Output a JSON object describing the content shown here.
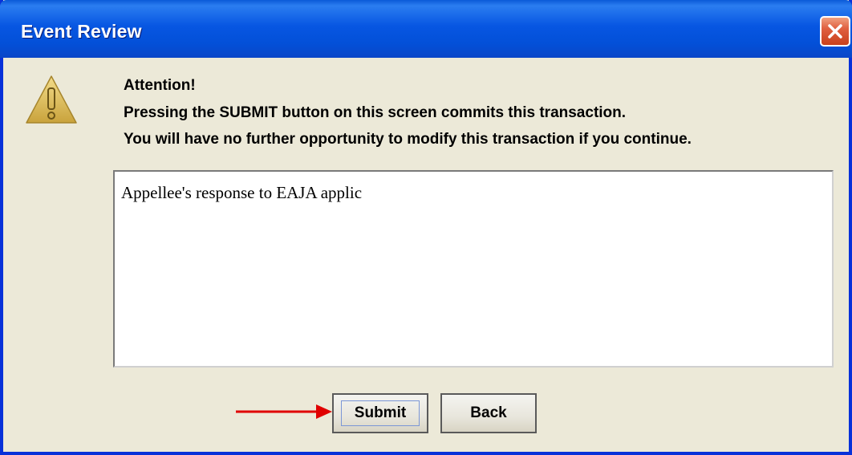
{
  "window": {
    "title": "Event Review"
  },
  "message": {
    "heading": "Attention!",
    "line1": "Pressing the SUBMIT button on this screen commits this transaction.",
    "line2": "You will have no further opportunity to modify this transaction if you continue."
  },
  "textarea": {
    "value": "Appellee's response to EAJA applic"
  },
  "buttons": {
    "submit_label": "Submit",
    "back_label": "Back"
  },
  "icons": {
    "warning": "warning-icon",
    "close": "close-icon",
    "arrow": "arrow-right-icon"
  },
  "colors": {
    "titlebar": "#0756e2",
    "close_button": "#e06040",
    "warning_icon": "#d9b84e",
    "arrow": "#e00000"
  }
}
